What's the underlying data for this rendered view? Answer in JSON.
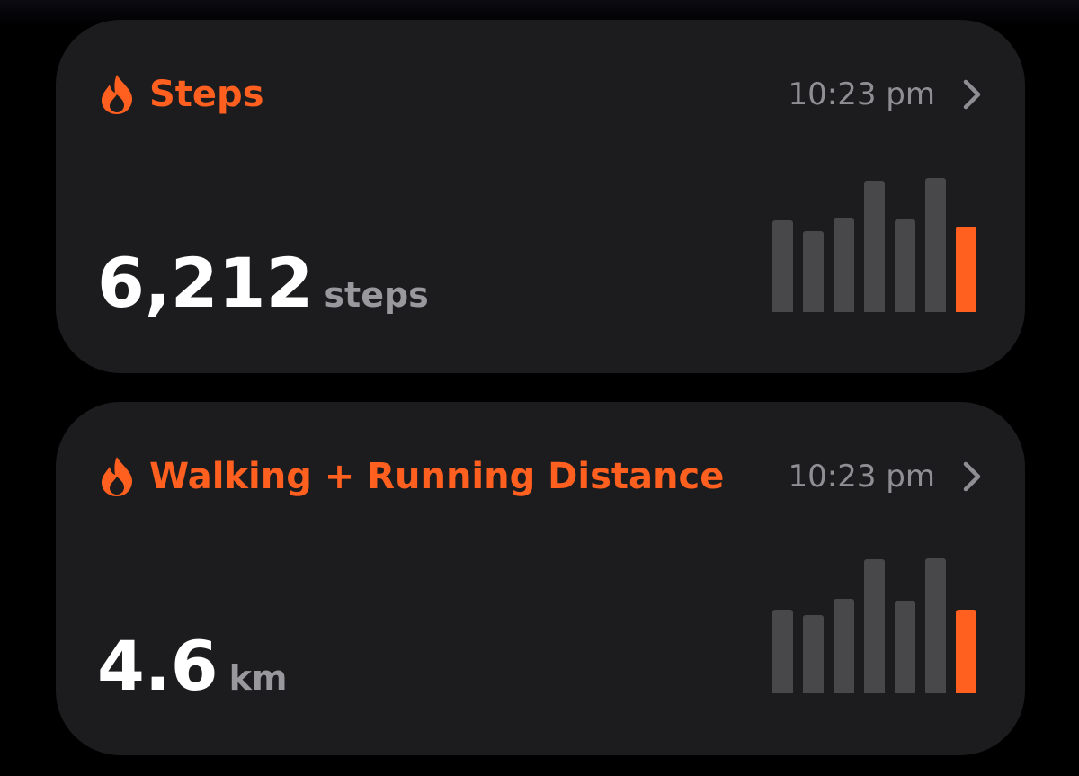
{
  "colors": {
    "accent": "#ff5f1f",
    "card_background": "#1c1c1e",
    "bar_inactive": "#48484a",
    "secondary_text": "#8e8e93"
  },
  "cards": [
    {
      "id": "steps",
      "icon": "flame-icon",
      "title": "Steps",
      "time": "10:23 pm",
      "value": "6,212",
      "unit": "steps",
      "bar_levels": [
        0.68,
        0.6,
        0.7,
        0.97,
        0.69,
        0.99,
        0.63
      ],
      "highlighted_bar": 6
    },
    {
      "id": "distance",
      "icon": "flame-icon",
      "title": "Walking + Running Distance",
      "time": "10:23 pm",
      "value": "4.6",
      "unit": "km",
      "bar_levels": [
        0.62,
        0.58,
        0.7,
        0.99,
        0.69,
        1.0,
        0.62
      ],
      "highlighted_bar": 6
    }
  ]
}
